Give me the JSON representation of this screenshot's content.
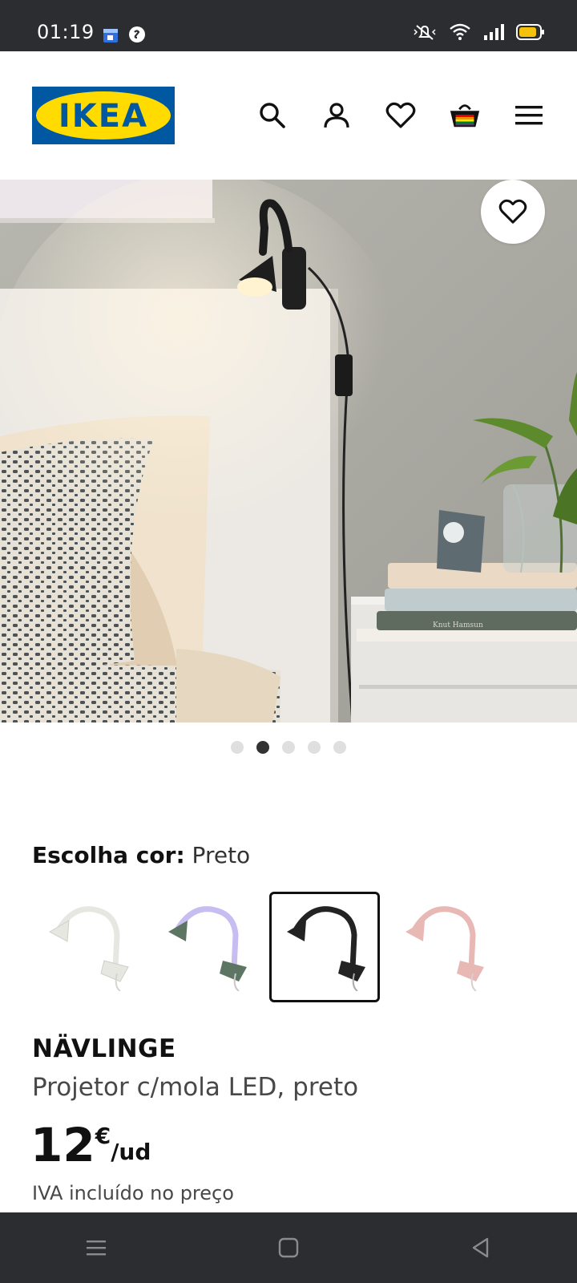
{
  "status_bar": {
    "time": "01:19"
  },
  "header": {
    "logo_text": "IKEA"
  },
  "product": {
    "color_label": "Escolha cor:",
    "color_value": "Preto",
    "name": "NÄVLINGE",
    "description": "Projetor c/mola LED, preto",
    "price_int": "12",
    "currency": "€",
    "unit": "/ud",
    "vat_note": "IVA incluído no preço"
  },
  "gallery": {
    "dots": 5,
    "active_dot": 2
  },
  "swatches": [
    {
      "name": "white",
      "color": "#e7e7e2"
    },
    {
      "name": "green-lilac",
      "color": "#5d7663"
    },
    {
      "name": "black",
      "color": "#232323"
    },
    {
      "name": "pink",
      "color": "#e8b8b5"
    }
  ]
}
